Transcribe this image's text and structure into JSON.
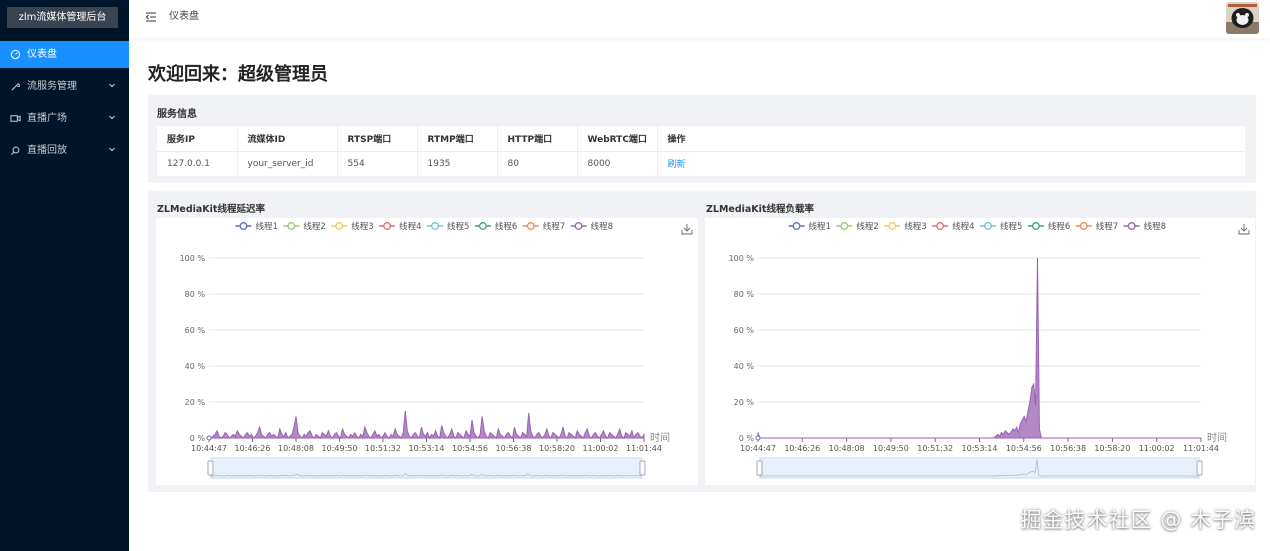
{
  "app": {
    "title": "zlm流媒体管理后台"
  },
  "sidebar": {
    "items": [
      {
        "label": "仪表盘",
        "icon": "dashboard-icon",
        "active": true,
        "expandable": false
      },
      {
        "label": "流服务管理",
        "icon": "tool-icon",
        "active": false,
        "expandable": true
      },
      {
        "label": "直播广场",
        "icon": "video-icon",
        "active": false,
        "expandable": true
      },
      {
        "label": "直播回放",
        "icon": "search-icon",
        "active": false,
        "expandable": true
      }
    ]
  },
  "header": {
    "breadcrumb": "仪表盘",
    "toggle_icon": "menu-fold-icon",
    "avatar_icon": "user-avatar"
  },
  "main": {
    "welcome": "欢迎回来：超级管理员",
    "service_info": {
      "title": "服务信息",
      "columns": [
        "服务IP",
        "流媒体ID",
        "RTSP端口",
        "RTMP端口",
        "HTTP端口",
        "WebRTC端口",
        "操作"
      ],
      "row": [
        "127.0.0.1",
        "your_server_id",
        "554",
        "1935",
        "80",
        "8000"
      ],
      "action_label": "刷新"
    }
  },
  "colors": {
    "sidebar_bg": "#001529",
    "accent": "#1890ff",
    "series": [
      "#5470c6",
      "#91cc75",
      "#fac858",
      "#ee6666",
      "#73c0de",
      "#3ba272",
      "#fc8452",
      "#9a60b4"
    ]
  },
  "watermark": "掘金技术社区 @ 木子滨",
  "chart_data": [
    {
      "type": "area",
      "title": "ZLMediaKit线程延迟率",
      "legend": [
        "线程1",
        "线程2",
        "线程3",
        "线程4",
        "线程5",
        "线程6",
        "线程7",
        "线程8"
      ],
      "legend_position": "top-center",
      "xlabel": "时间",
      "x_ticks": [
        "10:44:47",
        "10:46:26",
        "10:48:08",
        "10:49:50",
        "10:51:32",
        "10:53:14",
        "10:54:56",
        "10:56:38",
        "10:58:20",
        "11:00:02",
        "11:01:44"
      ],
      "y_ticks": [
        "0 %",
        "20 %",
        "40 %",
        "60 %",
        "80 %",
        "100 %"
      ],
      "ylim": [
        0,
        100
      ],
      "grid": true,
      "toolbox": "download",
      "datazoom": true,
      "series_shown": "线程8",
      "values": [
        0,
        0,
        1,
        2,
        4,
        1,
        0,
        1,
        3,
        2,
        0,
        1,
        2,
        1,
        4,
        2,
        1,
        0,
        2,
        3,
        1,
        2,
        0,
        1,
        3,
        6,
        2,
        1,
        0,
        2,
        3,
        1,
        2,
        1,
        0,
        5,
        2,
        1,
        3,
        0,
        1,
        2,
        6,
        12,
        3,
        1,
        0,
        2,
        1,
        3,
        4,
        1,
        0,
        2,
        1,
        0,
        3,
        2,
        1,
        4,
        1,
        0,
        2,
        3,
        1,
        0,
        5,
        2,
        1,
        0,
        2,
        1,
        3,
        1,
        0,
        2,
        1,
        6,
        3,
        1,
        0,
        2,
        4,
        1,
        2,
        0,
        1,
        3,
        1,
        0,
        2,
        1,
        5,
        2,
        1,
        0,
        3,
        15,
        4,
        1,
        0,
        2,
        3,
        1,
        0,
        6,
        2,
        1,
        3,
        0,
        2,
        1,
        4,
        1,
        0,
        7,
        3,
        1,
        0,
        2,
        5,
        1,
        0,
        3,
        2,
        1,
        0,
        4,
        2,
        1,
        10,
        3,
        1,
        0,
        2,
        12,
        4,
        1,
        0,
        3,
        2,
        1,
        0,
        5,
        2,
        1,
        0,
        2,
        3,
        1,
        0,
        6,
        2,
        1,
        0,
        3,
        2,
        1,
        14,
        4,
        1,
        0,
        2,
        3,
        1,
        0,
        2,
        5,
        1,
        0,
        3,
        2,
        1,
        0,
        2,
        6,
        1,
        0,
        3,
        2,
        1,
        0,
        4,
        2,
        1,
        0,
        3,
        5,
        1,
        0,
        2,
        3,
        1,
        0,
        2,
        4,
        1,
        0,
        3,
        2,
        1,
        0,
        2,
        5,
        1,
        0,
        3,
        2,
        1,
        4,
        0,
        2,
        3,
        1,
        0,
        2
      ]
    },
    {
      "type": "area",
      "title": "ZLMediaKit线程负载率",
      "legend": [
        "线程1",
        "线程2",
        "线程3",
        "线程4",
        "线程5",
        "线程6",
        "线程7",
        "线程8"
      ],
      "legend_position": "top-center",
      "xlabel": "时间",
      "x_ticks": [
        "10:44:47",
        "10:46:26",
        "10:48:08",
        "10:49:50",
        "10:51:32",
        "10:53:14",
        "10:54:56",
        "10:56:38",
        "10:58:20",
        "11:00:02",
        "11:01:44"
      ],
      "y_ticks": [
        "0 %",
        "20 %",
        "40 %",
        "60 %",
        "80 %",
        "100 %"
      ],
      "ylim": [
        0,
        100
      ],
      "grid": true,
      "toolbox": "download",
      "datazoom": true,
      "series_shown": "线程8",
      "values": [
        3,
        0,
        0,
        0,
        0,
        0,
        0,
        0,
        0,
        0,
        0,
        0,
        0,
        0,
        0,
        0,
        0,
        0,
        0,
        0,
        0,
        0,
        0,
        0,
        0,
        0,
        0,
        0,
        0,
        0,
        0,
        0,
        0,
        0,
        0,
        0,
        0,
        0,
        0,
        0,
        0,
        0,
        0,
        0,
        0,
        0,
        0,
        0,
        0,
        0,
        0,
        0,
        0,
        0,
        0,
        0,
        0,
        0,
        0,
        0,
        0,
        0,
        0,
        0,
        0,
        0,
        0,
        0,
        0,
        0,
        0,
        0,
        0,
        0,
        0,
        0,
        0,
        0,
        0,
        0,
        0,
        0,
        0,
        0,
        0,
        0,
        0,
        0,
        0,
        0,
        0,
        0,
        0,
        0,
        0,
        0,
        0,
        0,
        0,
        0,
        0,
        0,
        0,
        0,
        0,
        0,
        0,
        0,
        0,
        0,
        0,
        0,
        0,
        0,
        0,
        0,
        0,
        0,
        0,
        0,
        0,
        0,
        0,
        0,
        0,
        1,
        2,
        1,
        3,
        2,
        4,
        3,
        2,
        3,
        5,
        4,
        6,
        3,
        8,
        10,
        12,
        9,
        15,
        20,
        28,
        30,
        18,
        100,
        5,
        0,
        0,
        0,
        0,
        0,
        0,
        0,
        0,
        0,
        0,
        0,
        0,
        0,
        0,
        0,
        0,
        0,
        0,
        0,
        0,
        0,
        0,
        0,
        0,
        0,
        0,
        0,
        0,
        0,
        0,
        0,
        0,
        0,
        0,
        0,
        0,
        0,
        0,
        0,
        0,
        0,
        0,
        0,
        0,
        0,
        0,
        0,
        0,
        0,
        0,
        0,
        0,
        0,
        0,
        0,
        0,
        0,
        0,
        0,
        0,
        0,
        0,
        0,
        0,
        0,
        0,
        0,
        0,
        0,
        0,
        0,
        0,
        0,
        0,
        0,
        0,
        0,
        0,
        0,
        0,
        0,
        0,
        0,
        0,
        0
      ]
    }
  ]
}
